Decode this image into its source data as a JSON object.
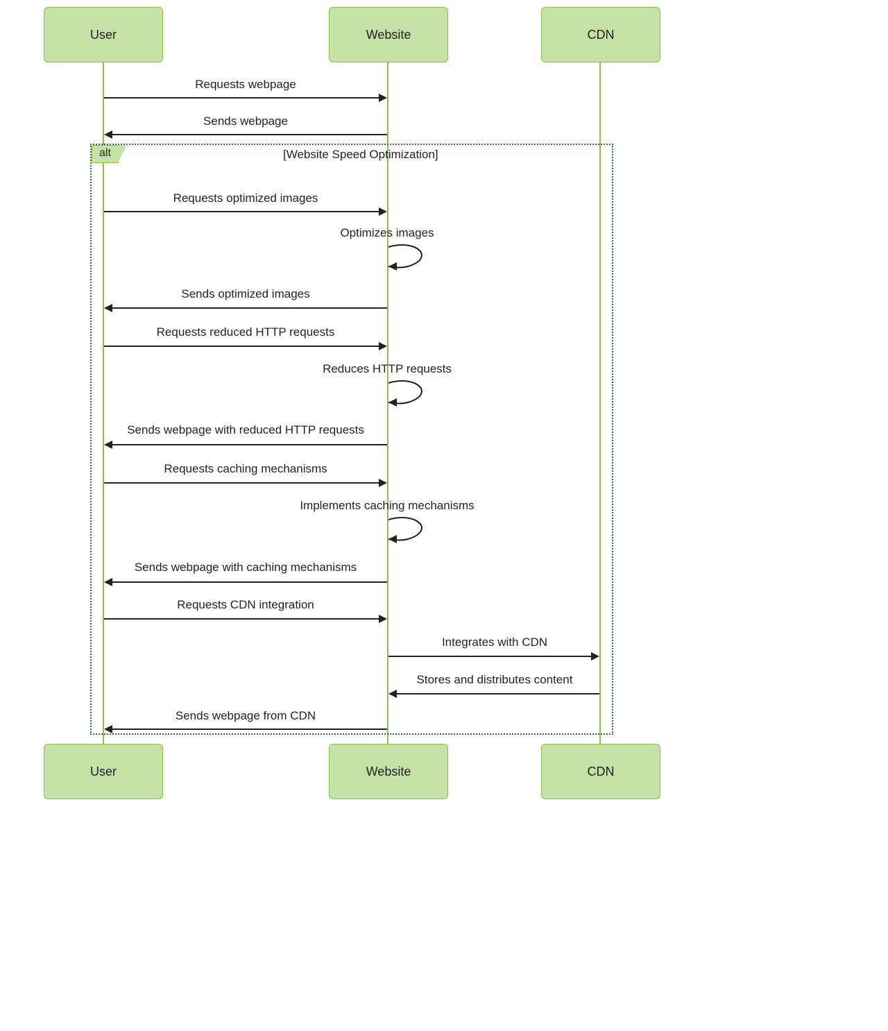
{
  "participants": {
    "user": "User",
    "website": "Website",
    "cdn": "CDN"
  },
  "alt": {
    "tag": "alt",
    "title": "[Website Speed Optimization]"
  },
  "messages": {
    "m1": "Requests webpage",
    "m2": "Sends webpage",
    "m3": "Requests optimized images",
    "m4": "Optimizes images",
    "m5": "Sends optimized images",
    "m6": "Requests reduced HTTP requests",
    "m7": "Reduces HTTP requests",
    "m8": "Sends webpage with reduced HTTP requests",
    "m9": "Requests caching mechanisms",
    "m10": "Implements caching mechanisms",
    "m11": "Sends webpage with caching mechanisms",
    "m12": "Requests CDN integration",
    "m13": "Integrates with CDN",
    "m14": "Stores and distributes content",
    "m15": "Sends webpage from CDN"
  }
}
